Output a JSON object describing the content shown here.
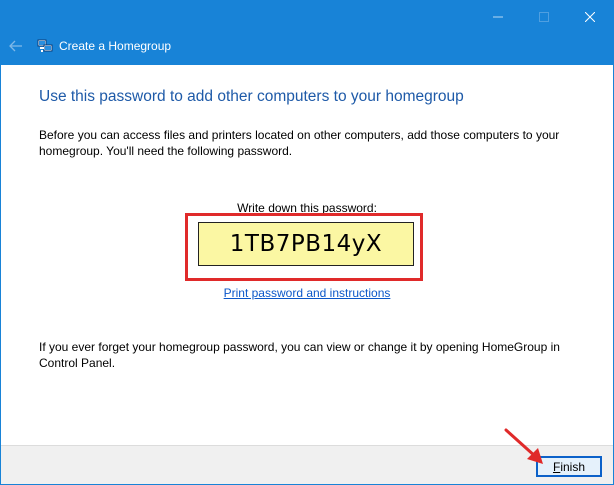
{
  "window": {
    "title": "Create a Homegroup",
    "controls": [
      "minimize-icon",
      "maximize-icon",
      "close-icon"
    ]
  },
  "content": {
    "heading": "Use this password to add other computers to your homegroup",
    "intro": "Before you can access files and printers located on other computers, add those computers to your homegroup. You'll need the following password.",
    "password_caption": "Write down this password:",
    "password": "1TB7PB14yX",
    "print_link": "Print password and instructions",
    "forget_note": "If you ever forget your homegroup password, you can view or change it by opening HomeGroup in Control Panel."
  },
  "footer": {
    "finish_label": "Finish",
    "finish_accelerator": "F",
    "finish_rest": "inish"
  },
  "colors": {
    "titlebar": "#1883d7",
    "heading": "#1e5aa8",
    "password_bg": "#fbf7a3",
    "highlight": "#e02a2a",
    "link": "#0b57c9"
  }
}
